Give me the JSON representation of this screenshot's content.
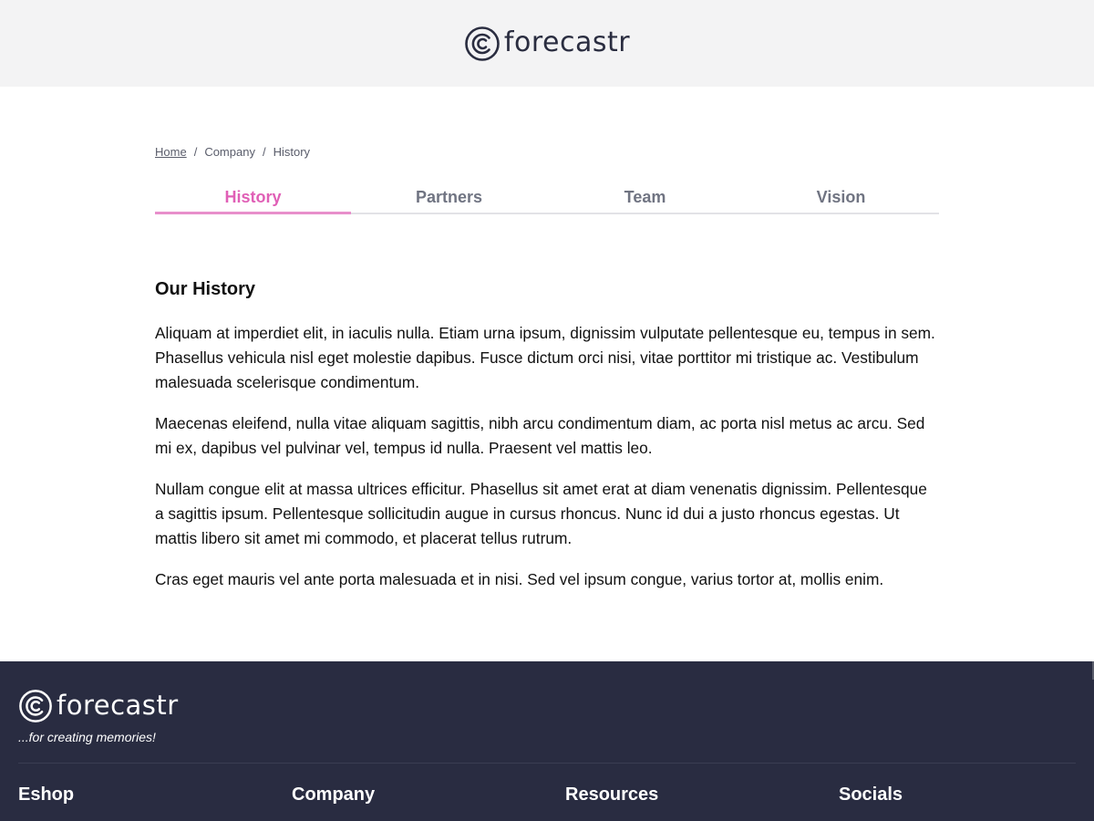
{
  "header": {
    "logo_text": "forecastr"
  },
  "breadcrumb": [
    {
      "label": "Home"
    },
    {
      "label": "Company"
    },
    {
      "label": "History"
    }
  ],
  "breadcrumb_separator": "/",
  "tabs": [
    {
      "label": "History",
      "active": true
    },
    {
      "label": "Partners",
      "active": false
    },
    {
      "label": "Team",
      "active": false
    },
    {
      "label": "Vision",
      "active": false
    }
  ],
  "content": {
    "title": "Our History",
    "paragraphs": [
      "Aliquam at imperdiet elit, in iaculis nulla. Etiam urna ipsum, dignissim vulputate pellentesque eu, tempus in sem. Phasellus vehicula nisl eget molestie dapibus. Fusce dictum orci nisi, vitae porttitor mi tristique ac. Vestibulum malesuada scelerisque condimentum.",
      "Maecenas eleifend, nulla vitae aliquam sagittis, nibh arcu condimentum diam, ac porta nisl metus ac arcu. Sed mi ex, dapibus vel pulvinar vel, tempus id nulla. Praesent vel mattis leo.",
      "Nullam congue elit at massa ultrices efficitur. Phasellus sit amet erat at diam venenatis dignissim. Pellentesque a sagittis ipsum. Pellentesque sollicitudin augue in cursus rhoncus. Nunc id dui a justo rhoncus egestas. Ut mattis libero sit amet mi commodo, et placerat tellus rutrum.",
      "Cras eget mauris vel ante porta malesuada et in nisi. Sed vel ipsum congue, varius tortor at, mollis enim."
    ]
  },
  "footer": {
    "logo_text": "forecastr",
    "tagline": "...for creating memories!",
    "columns": [
      {
        "title": "Eshop"
      },
      {
        "title": "Company"
      },
      {
        "title": "Resources"
      },
      {
        "title": "Socials"
      }
    ]
  },
  "colors": {
    "accent": "#e05fb6",
    "header_bg": "#f3f3f4",
    "footer_bg": "#292c41",
    "brand_text": "#2a2d40"
  },
  "icons": {
    "logo_mark": "forecastr-logo-icon"
  }
}
